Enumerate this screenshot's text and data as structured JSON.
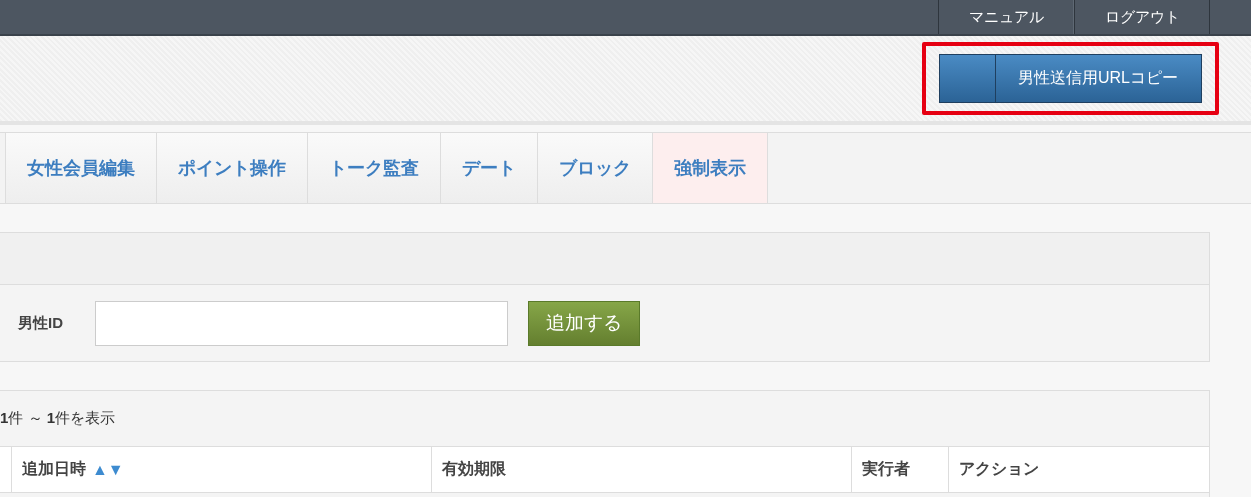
{
  "top_bar": {
    "links": [
      "マニュアル",
      "ログアウト"
    ]
  },
  "header": {
    "copy_button": {
      "label": "男性送信用URLコピー",
      "highlighted": true
    }
  },
  "tabs": [
    {
      "label": "女性会員編集",
      "selected": false
    },
    {
      "label": "ポイント操作",
      "selected": false
    },
    {
      "label": "トーク監査",
      "selected": false
    },
    {
      "label": "デート",
      "selected": false
    },
    {
      "label": "ブロック",
      "selected": false
    },
    {
      "label": "強制表示",
      "selected": true
    }
  ],
  "add_form": {
    "label": "男性ID",
    "button": "追加する"
  },
  "table": {
    "summary": "**1**件 ～ **1**件を表示",
    "columns": [
      {
        "label": "追加日時",
        "sort": "▲▼"
      },
      {
        "label": "有効期限"
      },
      {
        "label": "実行者"
      },
      {
        "label": "アクション"
      }
    ]
  }
}
